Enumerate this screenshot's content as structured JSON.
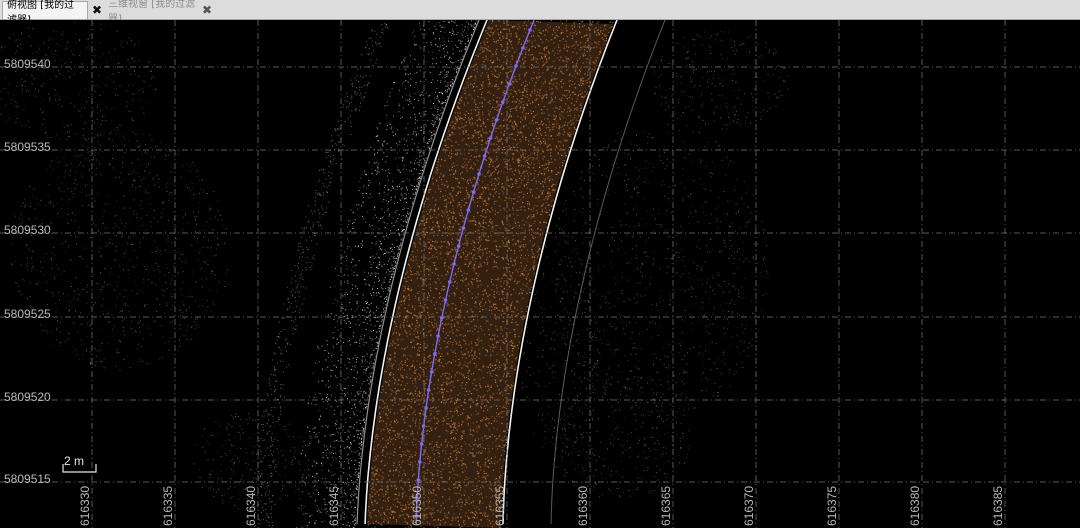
{
  "tabs": [
    {
      "label": "俯视图 [我的过滤器]",
      "active": true
    },
    {
      "label": "三维视窗 [我的过滤器]",
      "active": false
    }
  ],
  "close_glyph": "✖",
  "y_labels": [
    "5809540",
    "5809535",
    "5809530",
    "5809525",
    "5809520",
    "5809515"
  ],
  "x_labels": [
    "616330",
    "616335",
    "616340",
    "616345",
    "616350",
    "616355",
    "616360",
    "616365",
    "616370",
    "616375",
    "616380",
    "616385"
  ],
  "scale_bar": {
    "label": "2 m"
  },
  "colors": {
    "background": "#000000",
    "road_points": "#c9803e",
    "centerline": "#7b6cff",
    "edge_lines": "#ffffff",
    "vegetation": "#8a8a70",
    "grid": "#6e6e6e"
  }
}
